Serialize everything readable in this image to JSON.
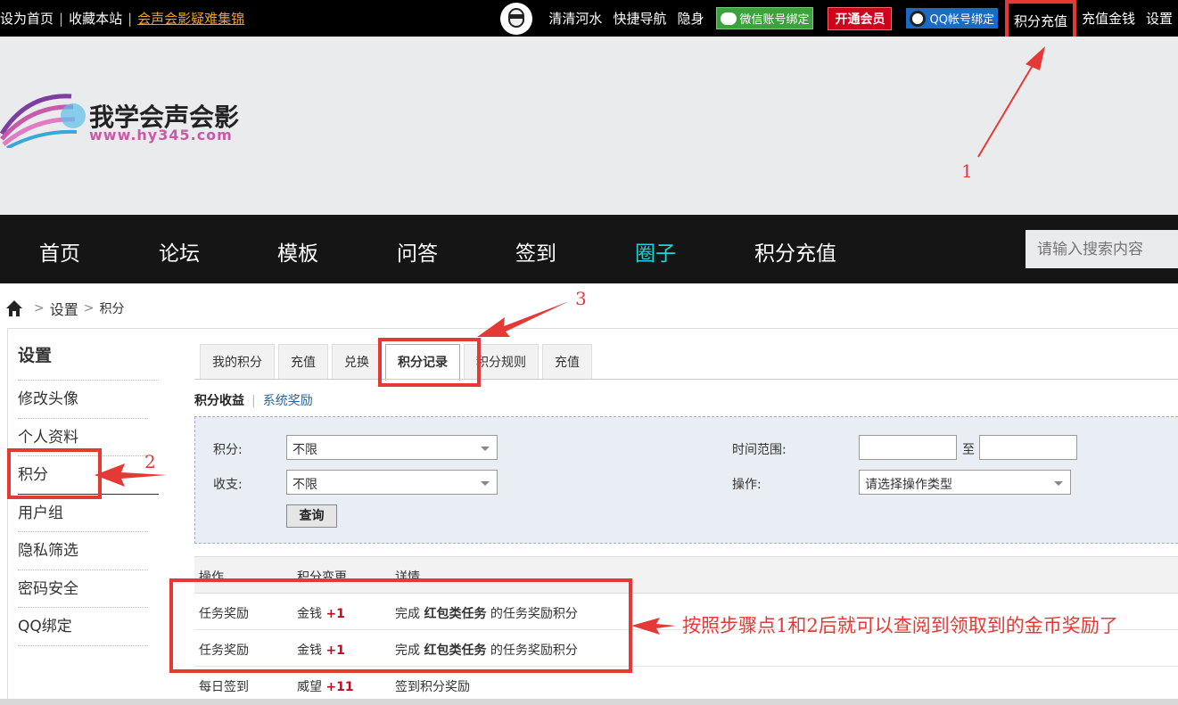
{
  "topbar": {
    "left": {
      "set_home": "设为首页",
      "bookmark": "收藏本站",
      "highlight_link": "会声会影疑难集锦"
    },
    "right": {
      "username": "清清河水",
      "quick_nav": "快捷导航",
      "invisible": "隐身",
      "wechat_bind": "微信账号绑定",
      "vip": "开通会员",
      "qq_bind": "QQ帐号绑定",
      "points_recharge": "积分充值",
      "money_recharge": "充值金钱",
      "settings": "设置"
    }
  },
  "logo": {
    "name": "我学会声会影",
    "url": "www.hy345.com"
  },
  "nav": {
    "items": [
      "首页",
      "论坛",
      "模板",
      "问答",
      "签到",
      "圈子",
      "积分充值"
    ],
    "active_index": 5,
    "active_color": "#19d5e0",
    "search_placeholder": "请输入搜索内容"
  },
  "breadcrumb": {
    "level1": "设置",
    "level2": "积分"
  },
  "sidebar": {
    "title": "设置",
    "items": [
      "修改头像",
      "个人资料",
      "积分",
      "用户组",
      "隐私筛选",
      "密码安全",
      "QQ绑定"
    ],
    "current_index": 2
  },
  "tabs": {
    "items": [
      "我的积分",
      "充值",
      "兑换",
      "积分记录",
      "积分规则",
      "充值"
    ],
    "active_index": 3
  },
  "subtabs": {
    "active": "积分收益",
    "other": "系统奖励"
  },
  "filter": {
    "points_label": "积分:",
    "points_value": "不限",
    "income_label": "收支:",
    "income_value": "不限",
    "query_button": "查询",
    "time_label": "时间范围:",
    "to_label": "至",
    "operation_label": "操作:",
    "operation_placeholder": "请选择操作类型"
  },
  "table": {
    "headers": [
      "操作",
      "积分变更",
      "详情"
    ],
    "rows": [
      {
        "op": "任务奖励",
        "unit": "金钱",
        "change": "+1",
        "pre": "完成 ",
        "bold": "红包类任务",
        "post": " 的任务奖励积分"
      },
      {
        "op": "任务奖励",
        "unit": "金钱",
        "change": "+1",
        "pre": "完成 ",
        "bold": "红包类任务",
        "post": " 的任务奖励积分"
      },
      {
        "op": "每日签到",
        "unit": "威望",
        "change": "+11",
        "pre": "",
        "bold": "",
        "post": "签到积分奖励"
      }
    ]
  },
  "annotations": {
    "step1": "1",
    "step2": "2",
    "step3": "3",
    "note": "按照步骤点1和2后就可以查阅到领取到的金币奖励了",
    "color": "#e53935"
  }
}
